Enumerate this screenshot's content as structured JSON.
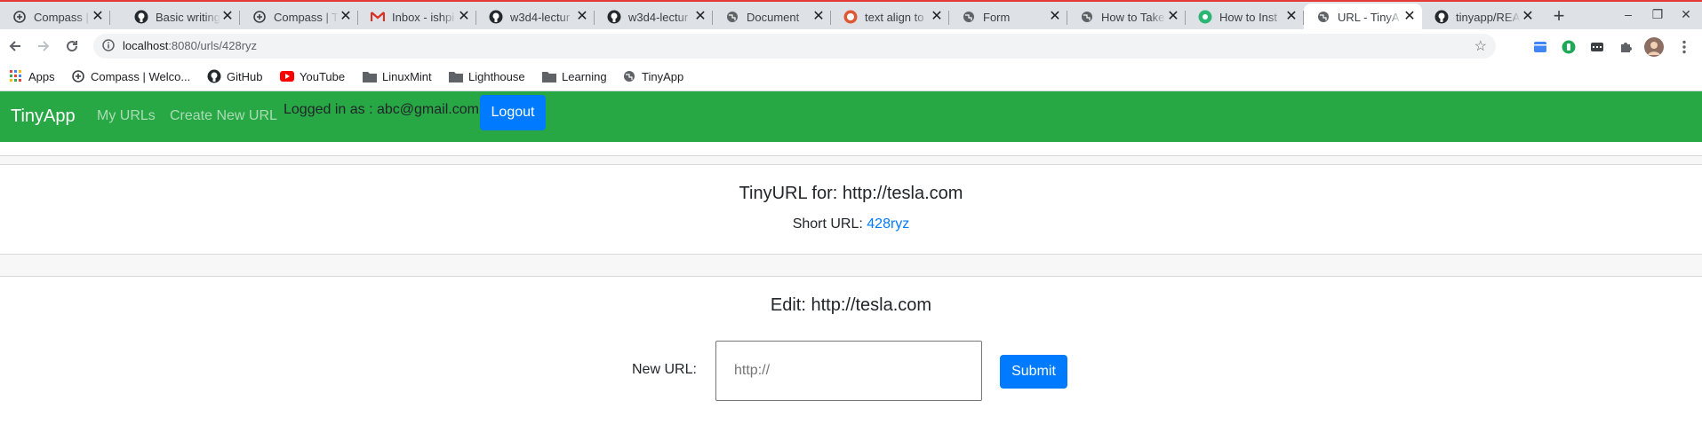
{
  "browser": {
    "tabs": [
      {
        "title": "Compass | S",
        "icon": "compass-icon",
        "active": false
      },
      {
        "title": "Basic writing",
        "icon": "github-icon",
        "active": false
      },
      {
        "title": "Compass | T",
        "icon": "compass-icon",
        "active": false
      },
      {
        "title": "Inbox - ishpi",
        "icon": "gmail-icon",
        "active": false
      },
      {
        "title": "w3d4-lectur",
        "icon": "github-icon",
        "active": false
      },
      {
        "title": "w3d4-lectur",
        "icon": "github-icon",
        "active": false
      },
      {
        "title": "Document",
        "icon": "globe-icon",
        "active": false
      },
      {
        "title": "text align to",
        "icon": "duckduckgo-icon",
        "active": false
      },
      {
        "title": "Form",
        "icon": "globe-icon",
        "active": false
      },
      {
        "title": "How to Take",
        "icon": "globe-icon",
        "active": false
      },
      {
        "title": "How to Inst",
        "icon": "green-circle-icon",
        "active": false
      },
      {
        "title": "URL - TinyA",
        "icon": "globe-icon",
        "active": true
      },
      {
        "title": "tinyapp/REA",
        "icon": "github-icon",
        "active": false
      }
    ],
    "url_host": "localhost",
    "url_path": ":8080/urls/428ryz",
    "bookmarks": [
      {
        "label": "Apps",
        "icon": "apps-grid-icon"
      },
      {
        "label": "Compass | Welco...",
        "icon": "compass-icon"
      },
      {
        "label": "GitHub",
        "icon": "github-icon"
      },
      {
        "label": "YouTube",
        "icon": "youtube-icon"
      },
      {
        "label": "LinuxMint",
        "icon": "folder-icon"
      },
      {
        "label": "Lighthouse",
        "icon": "folder-icon"
      },
      {
        "label": "Learning",
        "icon": "folder-icon"
      },
      {
        "label": "TinyApp",
        "icon": "globe-icon"
      }
    ]
  },
  "app": {
    "brand": "TinyApp",
    "nav": {
      "my_urls": "My URLs",
      "create_new": "Create New URL"
    },
    "logged_in": "Logged in as : abc@gmail.com",
    "logout": "Logout"
  },
  "url_card": {
    "title": "TinyURL for: http://tesla.com",
    "short_label": "Short URL:",
    "short_id": "428ryz"
  },
  "edit_card": {
    "title": "Edit: http://tesla.com",
    "label": "New URL:",
    "placeholder": "http://",
    "submit": "Submit"
  },
  "colors": {
    "navbar": "#28a745",
    "primary": "#007bff"
  }
}
